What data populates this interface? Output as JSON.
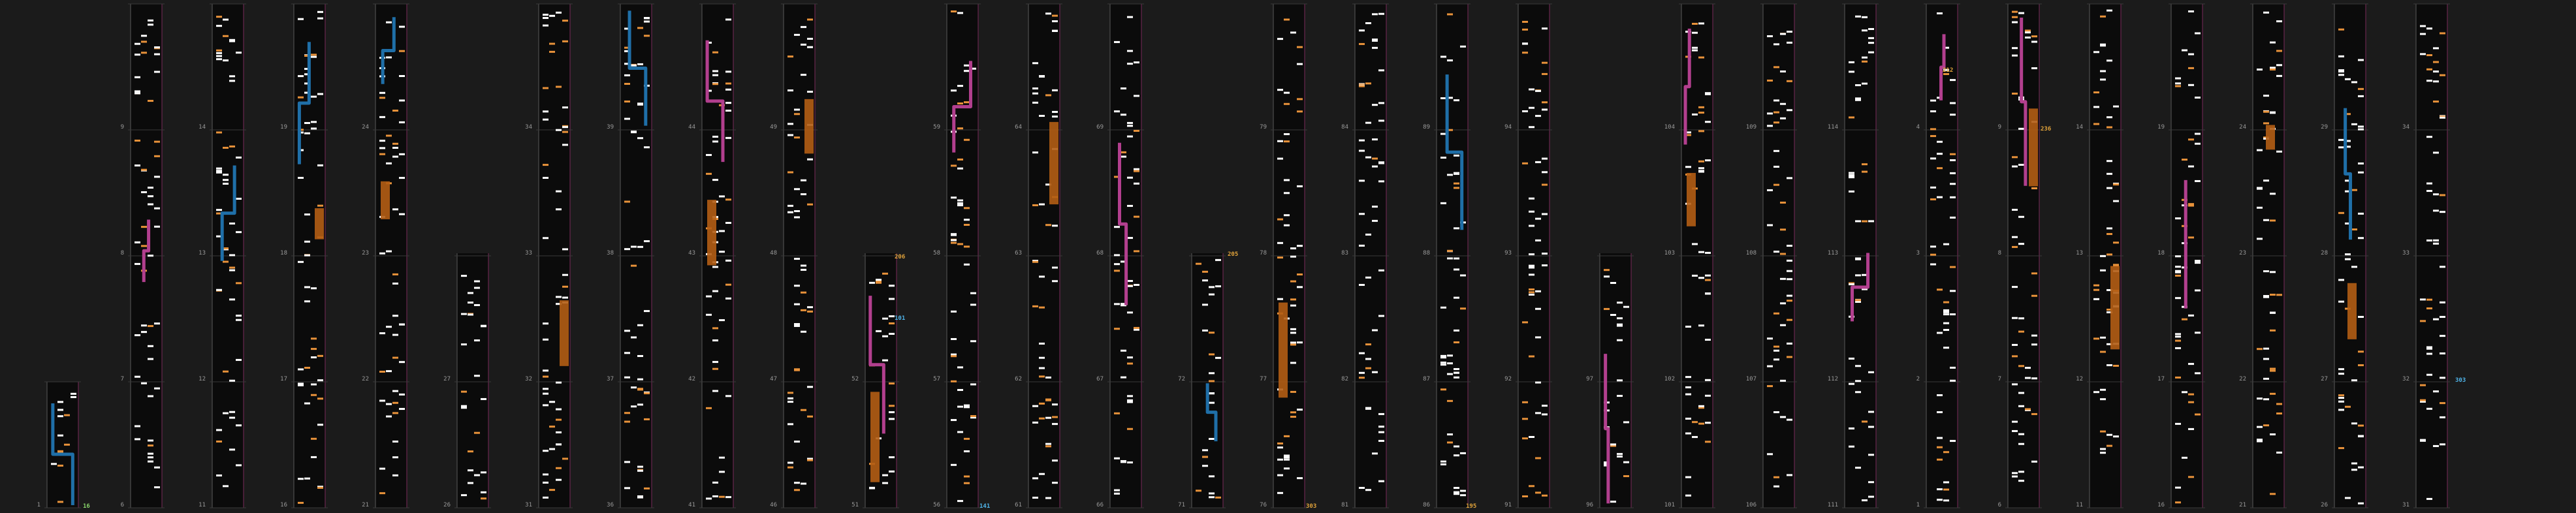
{
  "app": {
    "view": "chart-timeline-overview"
  },
  "colors": {
    "background": "#1b1b1b",
    "lane": "#0b0b0b",
    "lane_border": "#5a5a5a",
    "measure_line": "#3a3a3a",
    "tap": "#ffffff",
    "tap_alt": "#e8923a",
    "hold": "#b35d14",
    "slide_blue": "#1f6fa8",
    "slide_magenta": "#b23f8e",
    "combo_green": "#88d46a",
    "combo_yellow": "#e0a23a",
    "combo_cyan": "#4fb3e8"
  },
  "measure_labels": [
    [
      "1",
      "2",
      "3",
      "4",
      "5"
    ],
    [
      "6",
      "7",
      "8",
      "9",
      "10"
    ],
    [
      "11",
      "12",
      "13",
      "14",
      "15"
    ],
    [
      "16",
      "17",
      "18",
      "19",
      "20"
    ],
    [
      "21",
      "22",
      "23",
      "24",
      "25"
    ],
    [
      "26",
      "27",
      "28",
      "29",
      "30"
    ],
    [
      "31",
      "32",
      "33",
      "34",
      "35"
    ],
    [
      "36",
      "37",
      "38",
      "39",
      "40"
    ],
    [
      "41",
      "42",
      "43",
      "44",
      "45"
    ],
    [
      "46",
      "47",
      "48",
      "49",
      "50"
    ],
    [
      "51",
      "52",
      "53",
      "54",
      "55"
    ],
    [
      "56",
      "57",
      "58",
      "59",
      "60"
    ],
    [
      "61",
      "62",
      "63",
      "64",
      "65"
    ],
    [
      "66",
      "67",
      "68",
      "69",
      "70"
    ],
    [
      "71",
      "72",
      "73",
      "74",
      "75"
    ],
    [
      "76",
      "77",
      "78",
      "79",
      "80"
    ],
    [
      "81",
      "82",
      "83",
      "84",
      "85"
    ],
    [
      "86",
      "87",
      "88",
      "89",
      "90"
    ],
    [
      "91",
      "92",
      "93",
      "94",
      "95"
    ],
    [
      "96",
      "97",
      "98",
      "99",
      "100"
    ],
    [
      "101",
      "102",
      "103",
      "104",
      "105"
    ],
    [
      "106",
      "107",
      "108",
      "109",
      "110"
    ],
    [
      "111",
      "112",
      "113",
      "114",
      "115"
    ]
  ],
  "combo_labels": [
    {
      "text": "16",
      "color": "green"
    },
    {
      "text": "101",
      "color": "cyan"
    },
    {
      "text": "206",
      "color": "yellow"
    },
    {
      "text": "141",
      "color": "cyan"
    },
    {
      "text": "205",
      "color": "yellow"
    },
    {
      "text": "303",
      "color": "yellow"
    },
    {
      "text": "195",
      "color": "yellow"
    },
    {
      "text": "212",
      "color": "yellow"
    },
    {
      "text": "236",
      "color": "yellow"
    },
    {
      "text": "303",
      "color": "cyan"
    }
  ]
}
